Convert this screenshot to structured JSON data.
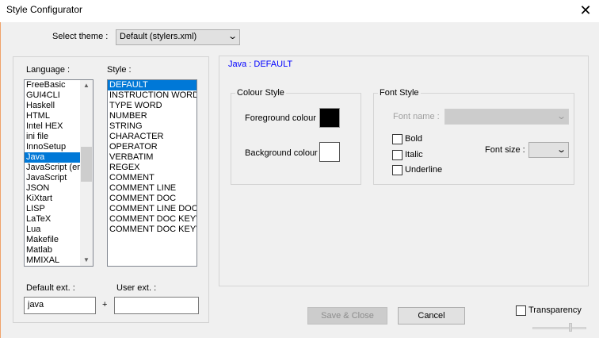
{
  "window": {
    "title": "Style Configurator",
    "close_glyph": "✕"
  },
  "theme": {
    "label": "Select theme :",
    "selected": "Default (stylers.xml)"
  },
  "language": {
    "label": "Language :",
    "items": [
      "FreeBasic",
      "GUI4CLI",
      "Haskell",
      "HTML",
      "Intel HEX",
      "ini file",
      "InnoSetup",
      "Java",
      "JavaScript (em",
      "JavaScript",
      "JSON",
      "KiXtart",
      "LISP",
      "LaTeX",
      "Lua",
      "Makefile",
      "Matlab",
      "MMIXAL"
    ],
    "selected_index": 7
  },
  "style": {
    "label": "Style :",
    "items": [
      "DEFAULT",
      "INSTRUCTION WORD",
      "TYPE WORD",
      "NUMBER",
      "STRING",
      "CHARACTER",
      "OPERATOR",
      "VERBATIM",
      "REGEX",
      "COMMENT",
      "COMMENT LINE",
      "COMMENT DOC",
      "COMMENT LINE DOC",
      "COMMENT DOC KEYWO",
      "COMMENT DOC KEYWO"
    ],
    "selected_index": 0
  },
  "extensions": {
    "default_label": "Default ext. :",
    "default_value": "java",
    "plus": "+",
    "user_label": "User ext. :",
    "user_value": ""
  },
  "panel": {
    "heading": "Java : DEFAULT"
  },
  "colour_style": {
    "title": "Colour Style",
    "foreground_label": "Foreground colour",
    "foreground_color": "#000000",
    "background_label": "Background colour",
    "background_color": "#ffffff"
  },
  "font_style": {
    "title": "Font Style",
    "font_name_label": "Font name :",
    "font_name_value": "",
    "bold_label": "Bold",
    "bold_checked": false,
    "italic_label": "Italic",
    "italic_checked": false,
    "underline_label": "Underline",
    "underline_checked": false,
    "font_size_label": "Font size :",
    "font_size_value": ""
  },
  "buttons": {
    "save_close": "Save & Close",
    "cancel": "Cancel"
  },
  "transparency": {
    "label": "Transparency",
    "checked": false
  },
  "icons": {
    "chevron": "chevron-down-icon",
    "close": "close-icon"
  }
}
